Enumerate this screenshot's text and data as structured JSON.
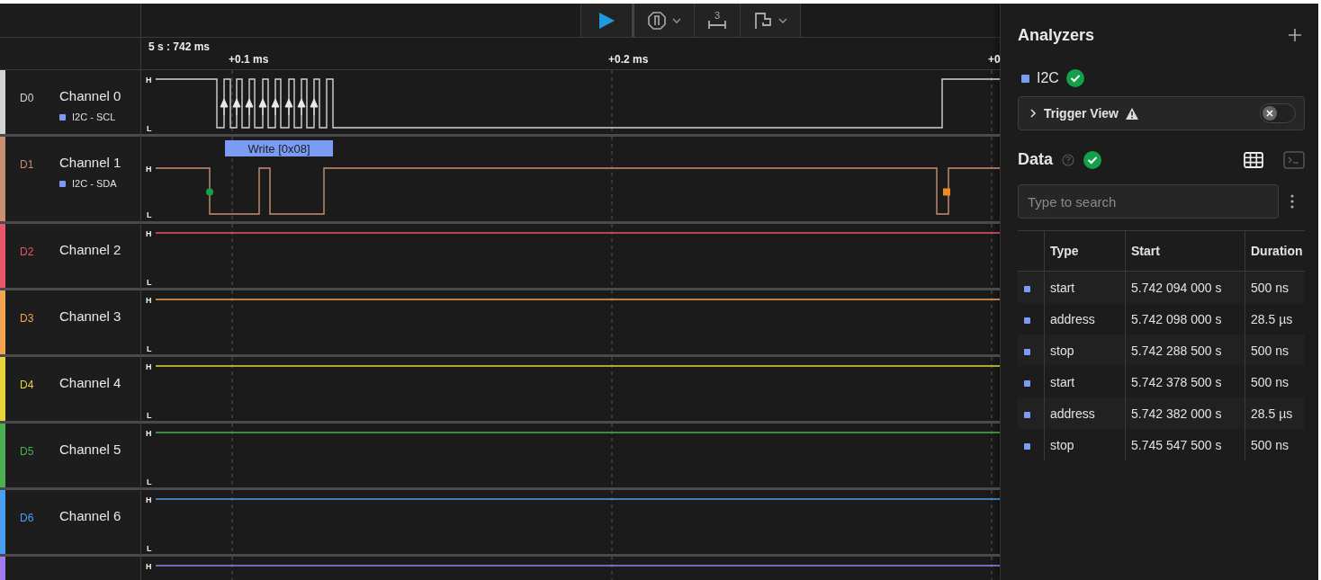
{
  "toolbar": [
    {
      "kind": "play",
      "dropdown": false
    },
    {
      "kind": "trigger",
      "dropdown": true
    },
    {
      "kind": "measure",
      "label": "3",
      "dropdown": false
    },
    {
      "kind": "marker",
      "dropdown": true
    }
  ],
  "timeline": {
    "origin": "5 s : 742 ms",
    "markers": [
      "+0.1 ms",
      "+0.2 ms",
      "+0"
    ]
  },
  "channels": [
    {
      "id": "D0",
      "name": "Channel 0",
      "color": "#d4d4d4",
      "kind": "clock",
      "high_label": "H",
      "low_label": "L",
      "decoder": {
        "label": "I2C - SCL",
        "color": "#7b9cf5"
      }
    },
    {
      "id": "D1",
      "name": "Channel 1",
      "color": "#c98f72",
      "kind": "data",
      "high_label": "H",
      "low_label": "L",
      "decoder": {
        "label": "I2C - SDA",
        "color": "#7b9cf5"
      },
      "annotation": "Write [0x08]"
    },
    {
      "id": "D2",
      "name": "Channel 2",
      "color": "#e8566a",
      "kind": "idle",
      "high_label": "H",
      "low_label": "L"
    },
    {
      "id": "D3",
      "name": "Channel 3",
      "color": "#f2a450",
      "kind": "idle",
      "high_label": "H",
      "low_label": "L"
    },
    {
      "id": "D4",
      "name": "Channel 4",
      "color": "#e6d43a",
      "kind": "idle",
      "high_label": "H",
      "low_label": "L"
    },
    {
      "id": "D5",
      "name": "Channel 5",
      "color": "#4caf50",
      "kind": "idle",
      "high_label": "H",
      "low_label": "L"
    },
    {
      "id": "D6",
      "name": "Channel 6",
      "color": "#4a9ff5",
      "kind": "idle",
      "high_label": "H",
      "low_label": "L"
    },
    {
      "color": "#a07cf0",
      "kind": "idle",
      "high_label": "H"
    }
  ],
  "panel": {
    "title": "Analyzers",
    "analyzers": [
      {
        "name": "I2C",
        "color": "#7b9cf5",
        "ok": true
      }
    ],
    "trigger_view": {
      "label": "Trigger View",
      "warning": true,
      "on": false
    },
    "data": {
      "title": "Data",
      "ok": true,
      "search": {
        "placeholder": "Type to search"
      },
      "table": {
        "columns": [
          "Type",
          "Start",
          "Duration"
        ],
        "rows": [
          {
            "type": "start",
            "start": "5.742 094 000 s",
            "duration": "500 ns",
            "color": "#7b9cf5"
          },
          {
            "type": "address",
            "start": "5.742 098 000 s",
            "duration": "28.5 µs",
            "color": "#7b9cf5"
          },
          {
            "type": "stop",
            "start": "5.742 288 500 s",
            "duration": "500 ns",
            "color": "#7b9cf5"
          },
          {
            "type": "start",
            "start": "5.742 378 500 s",
            "duration": "500 ns",
            "color": "#7b9cf5"
          },
          {
            "type": "address",
            "start": "5.742 382 000 s",
            "duration": "28.5 µs",
            "color": "#7b9cf5"
          },
          {
            "type": "stop",
            "start": "5.745 547 500 s",
            "duration": "500 ns",
            "color": "#7b9cf5"
          }
        ]
      }
    }
  }
}
